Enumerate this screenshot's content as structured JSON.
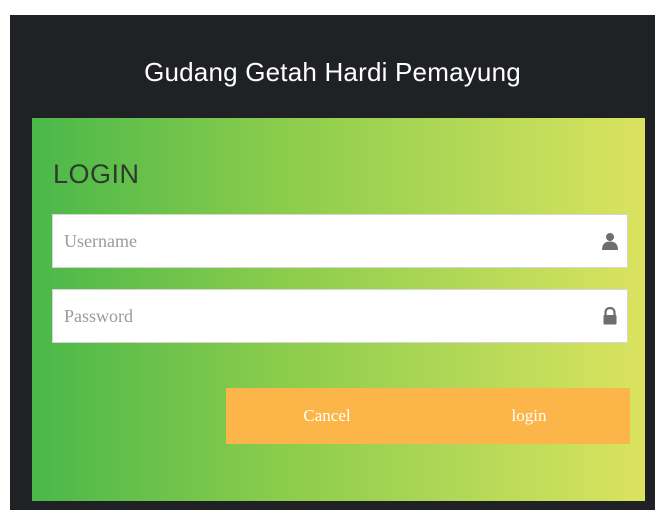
{
  "app": {
    "title": "Gudang Getah Hardi Pemayung"
  },
  "login_form": {
    "heading": "LOGIN",
    "username": {
      "value": "",
      "placeholder": "Username",
      "icon": "user-icon"
    },
    "password": {
      "value": "",
      "placeholder": "Password",
      "icon": "lock-icon"
    },
    "cancel_label": "Cancel",
    "login_label": "login"
  },
  "colors": {
    "window_background": "#1f2125",
    "gradient_start": "#4ab84a",
    "gradient_end": "#dbe35f",
    "button_background": "#fcb549",
    "button_text": "#ffffff"
  }
}
